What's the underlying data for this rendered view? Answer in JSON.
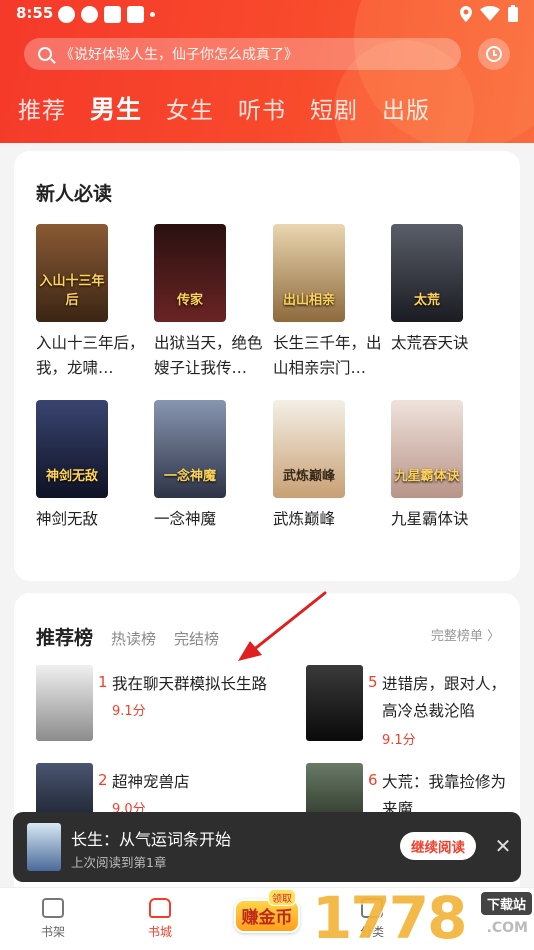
{
  "status_bar": {
    "time": "8:55"
  },
  "search": {
    "placeholder": "《说好体验人生，仙子你怎么成真了》"
  },
  "top_tabs": [
    {
      "label": "推荐",
      "active": false
    },
    {
      "label": "男生",
      "active": true
    },
    {
      "label": "女生",
      "active": false
    },
    {
      "label": "听书",
      "active": false
    },
    {
      "label": "短剧",
      "active": false
    },
    {
      "label": "出版",
      "active": false
    }
  ],
  "newbie": {
    "title": "新人必读",
    "books": [
      {
        "name": "入山十三年后，我，龙啸…",
        "cover_text": "入山十三年后",
        "cover_color": "#6b3e22"
      },
      {
        "name": "出狱当天，绝色嫂子让我传…",
        "cover_text": "传家",
        "cover_color": "#3a1a1a"
      },
      {
        "name": "长生三千年，出山相亲宗门…",
        "cover_text": "出山相亲",
        "cover_color": "#c9a36a"
      },
      {
        "name": "太荒吞天诀",
        "cover_text": "太荒",
        "cover_color": "#2a2e38"
      },
      {
        "name": "神剑无敌",
        "cover_text": "神剑无敌",
        "cover_color": "#1d2340"
      },
      {
        "name": "一念神魔",
        "cover_text": "一念神魔",
        "cover_color": "#5a6a88"
      },
      {
        "name": "武炼巅峰",
        "cover_text": "武炼巅峰",
        "cover_color": "#e9e2d6"
      },
      {
        "name": "九星霸体诀",
        "cover_text": "九星霸体诀",
        "cover_color": "#d9c7c0"
      }
    ]
  },
  "rank": {
    "tabs": [
      {
        "label": "推荐榜",
        "active": true
      },
      {
        "label": "热读榜",
        "active": false
      },
      {
        "label": "完结榜",
        "active": false
      }
    ],
    "full_list": "完整榜单 〉",
    "items": [
      {
        "num": "1",
        "title": "我在聊天群模拟长生路",
        "score": "9.1分",
        "cover_color": "#d8d8d8"
      },
      {
        "num": "5",
        "title": "进错房，跟对人，高冷总裁沦陷",
        "score": "9.1分",
        "cover_color": "#222"
      },
      {
        "num": "2",
        "title": "超神宠兽店",
        "score": "9.0分",
        "cover_color": "#2b3040"
      },
      {
        "num": "6",
        "title": "大荒：我靠捡修为来魔",
        "score": "",
        "cover_color": "#3d4a3c"
      }
    ]
  },
  "continue_bar": {
    "title": "长生：从气运词条开始",
    "subtitle": "上次阅读到第1章",
    "button": "继续阅读",
    "close": "✕"
  },
  "bottom_nav": {
    "bookshelf": "书架",
    "bookstore": "书城",
    "earn": "赚金币",
    "earn_badge": "领取",
    "category": "分类"
  },
  "watermark": {
    "digits": "1778",
    "download": "下载站",
    "com": ".COM"
  }
}
